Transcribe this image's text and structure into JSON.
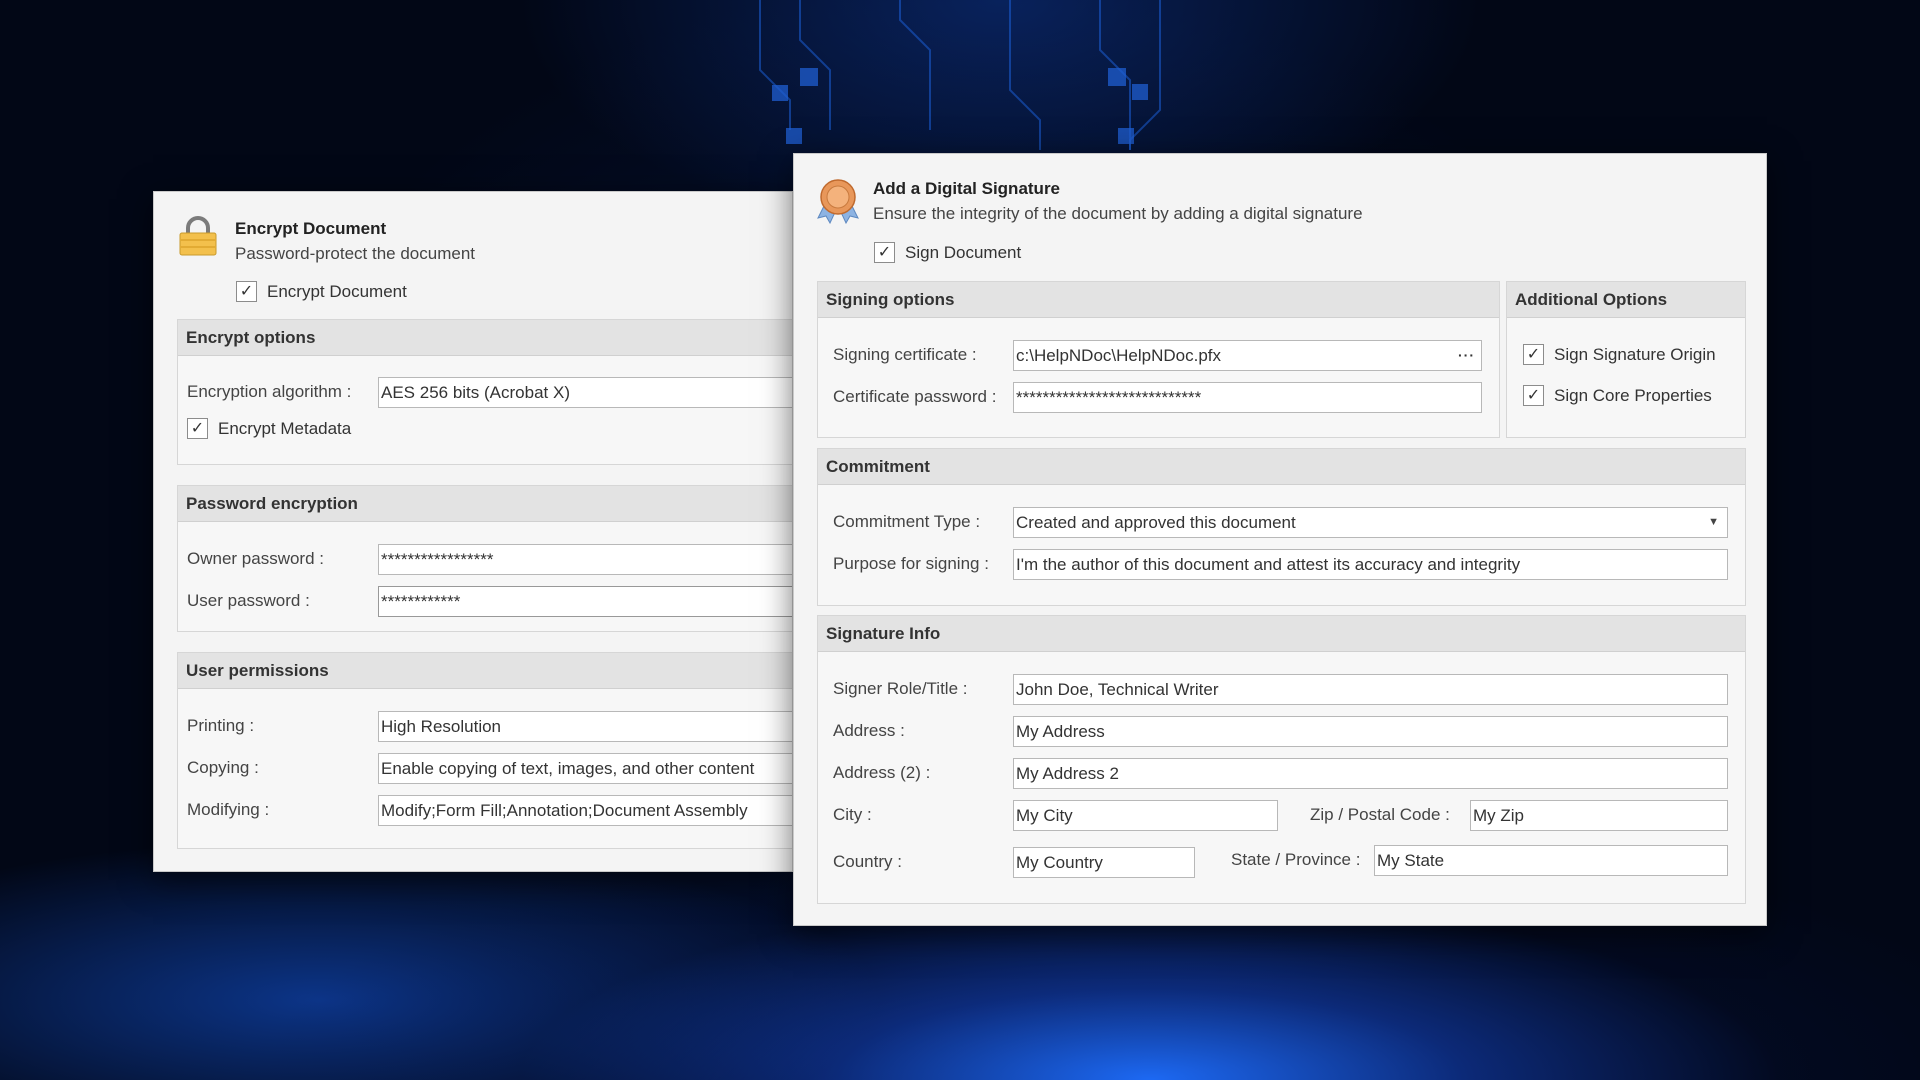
{
  "encrypt": {
    "title": "Encrypt Document",
    "subtitle": "Password-protect the document",
    "encrypt_checkbox": {
      "label": "Encrypt Document",
      "checked": true
    },
    "options": {
      "header": "Encrypt options",
      "algorithm_label": "Encryption algorithm :",
      "algorithm_value": "AES 256 bits (Acrobat X)",
      "metadata_checkbox": {
        "label": "Encrypt Metadata",
        "checked": true
      }
    },
    "password": {
      "header": "Password encryption",
      "owner_label": "Owner password :",
      "owner_value": "*****************",
      "user_label": "User password :",
      "user_value": "************"
    },
    "permissions": {
      "header": "User permissions",
      "printing_label": "Printing :",
      "printing_value": "High Resolution",
      "copying_label": "Copying :",
      "copying_value": "Enable copying of text, images, and other content",
      "modifying_label": "Modifying :",
      "modifying_value": "Modify;Form Fill;Annotation;Document Assembly"
    }
  },
  "signature": {
    "title": "Add a Digital Signature",
    "subtitle": "Ensure the integrity of the document by adding a digital signature",
    "sign_checkbox": {
      "label": "Sign Document",
      "checked": true
    },
    "signing": {
      "header": "Signing options",
      "cert_label": "Signing certificate :",
      "cert_value": "c:\\HelpNDoc\\HelpNDoc.pfx",
      "cert_browse": "···",
      "password_label": "Certificate password :",
      "password_value": "****************************"
    },
    "additional": {
      "header": "Additional Options",
      "origin_checkbox": {
        "label": "Sign Signature Origin",
        "checked": true
      },
      "core_checkbox": {
        "label": "Sign Core Properties",
        "checked": true
      }
    },
    "commitment": {
      "header": "Commitment",
      "type_label": "Commitment Type :",
      "type_value": "Created and approved this document",
      "purpose_label": "Purpose for signing :",
      "purpose_value": "I'm the author of this document and attest its accuracy and integrity"
    },
    "info": {
      "header": "Signature Info",
      "role_label": "Signer Role/Title :",
      "role_value": "John Doe, Technical Writer",
      "address_label": "Address :",
      "address_value": "My Address",
      "address2_label": "Address (2) :",
      "address2_value": "My Address 2",
      "city_label": "City :",
      "city_value": "My City",
      "zip_label": "Zip / Postal Code :",
      "zip_value": "My Zip",
      "country_label": "Country :",
      "country_value": "My Country",
      "state_label": "State / Province :",
      "state_value": "My State"
    }
  },
  "icons": {
    "lock": "lock-icon",
    "ribbon": "award-ribbon-icon",
    "check": "✓",
    "dropdown": "▼"
  },
  "colors": {
    "background": "#02081a",
    "glow": "#1e6eff",
    "panel": "#f4f4f4",
    "group_header": "#e3e3e3"
  }
}
